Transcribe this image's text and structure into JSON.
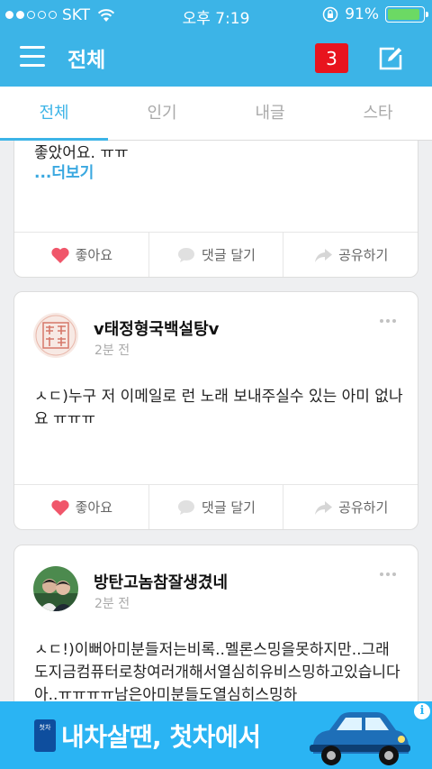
{
  "status_bar": {
    "carrier": "SKT",
    "time": "오후 7:19",
    "battery": "91%",
    "battery_level": 0.91
  },
  "nav": {
    "title": "전체",
    "notification_count": "3"
  },
  "tabs": [
    {
      "label": "전체",
      "active": true
    },
    {
      "label": "인기",
      "active": false
    },
    {
      "label": "내글",
      "active": false
    },
    {
      "label": "스타",
      "active": false
    }
  ],
  "posts": [
    {
      "partial_text": "좋았어요. ㅠㅠ",
      "more": "...더보기",
      "actions": {
        "like": "좋아요",
        "comment": "댓글 달기",
        "share": "공유하기"
      }
    },
    {
      "author": "v태정형국백설탕v",
      "time": "2분 전",
      "body": "ㅅㄷ)누구 저 이메일로 런 노래 보내주실수 있는 아미 없나요 ㅠㅠㅠ",
      "actions": {
        "like": "좋아요",
        "comment": "댓글 달기",
        "share": "공유하기"
      }
    },
    {
      "author": "방탄고놈참잘생겼네",
      "time": "2분 전",
      "body": "ㅅㄷ!)이뻐아미분들저는비록..멜론스밍을못하지만..그래도지금컴퓨터로창여러개해서열심히유비스밍하고있습니다아..ㅠㅠㅠㅠ남은아미분들도열심히스밍하"
    }
  ],
  "ad": {
    "text": "내차살땐, 첫차에서",
    "logo_text": "첫차",
    "info": "i"
  },
  "colors": {
    "primary": "#3cb4e7",
    "badge": "#e8141e",
    "like": "#f0566a",
    "ad_bg": "#2ab4f3"
  },
  "icons": [
    "menu-icon",
    "compose-icon",
    "heart-icon",
    "comment-icon",
    "share-icon",
    "wifi-icon",
    "rotation-lock-icon",
    "battery-icon"
  ]
}
